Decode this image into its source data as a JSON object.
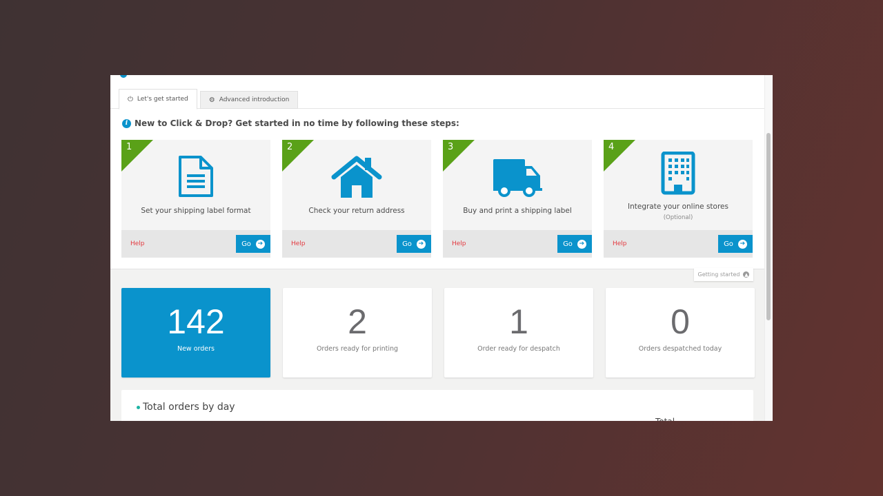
{
  "tabs": [
    {
      "label": "Let's get started",
      "icon": "power-icon",
      "active": true
    },
    {
      "label": "Advanced introduction",
      "icon": "gears-icon",
      "active": false
    }
  ],
  "intro": {
    "icon": "info-icon",
    "text": "New to Click & Drop? Get started in no time by following these steps:"
  },
  "steps": [
    {
      "number": "1",
      "icon": "document-icon",
      "title": "Set your shipping label format",
      "subtitle": "",
      "help": "Help",
      "go": "Go"
    },
    {
      "number": "2",
      "icon": "house-icon",
      "title": "Check your return address",
      "subtitle": "",
      "help": "Help",
      "go": "Go"
    },
    {
      "number": "3",
      "icon": "truck-icon",
      "title": "Buy and print a shipping label",
      "subtitle": "",
      "help": "Help",
      "go": "Go"
    },
    {
      "number": "4",
      "icon": "building-icon",
      "title": "Integrate your online stores",
      "subtitle": "(Optional)",
      "help": "Help",
      "go": "Go"
    }
  ],
  "getting_started_toggle": "Getting started",
  "stats": [
    {
      "value": "142",
      "label": "New orders",
      "highlighted": true
    },
    {
      "value": "2",
      "label": "Orders ready for printing",
      "highlighted": false
    },
    {
      "value": "1",
      "label": "Order ready for despatch",
      "highlighted": false
    },
    {
      "value": "0",
      "label": "Orders despatched today",
      "highlighted": false
    }
  ],
  "chart_panel": {
    "title": "Total orders by day",
    "column_header_partial": "Total"
  },
  "colors": {
    "accent_blue": "#0a93cc",
    "step_green": "#5aa118",
    "help_red": "#e3373d",
    "legend_teal": "#1db3a3"
  }
}
